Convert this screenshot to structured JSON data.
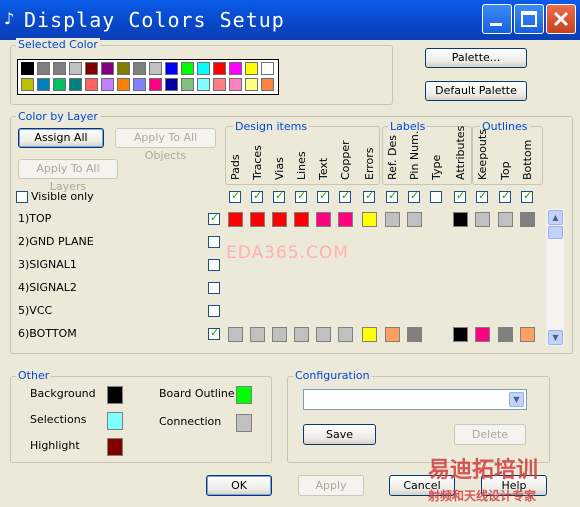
{
  "window": {
    "title": "Display Colors Setup"
  },
  "selected_color": {
    "label": "Selected Color",
    "row1": [
      "#000000",
      "#808080",
      "#808080",
      "#C0C0C0",
      "#800000",
      "#800080",
      "#808000",
      "#808080",
      "#C0C0C0",
      "#0000FF",
      "#00FF00",
      "#00FFFF",
      "#FF0000",
      "#FF00FF",
      "#FFFF00",
      "#FFFFFF"
    ],
    "row2": [
      "#C0C000",
      "#0080C0",
      "#00C060",
      "#008080",
      "#FF6060",
      "#C080FF",
      "#FF8000",
      "#8080FF",
      "#FF0080",
      "#0000A0",
      "#80C080",
      "#80FFFF",
      "#FF8080",
      "#FF80C0",
      "#FFFF80",
      "#FF8040"
    ]
  },
  "buttons": {
    "palette": "Palette...",
    "default_palette": "Default Palette",
    "assign_all": "Assign All",
    "apply_all_objects": "Apply To All Objects",
    "apply_all_layers": "Apply To All Layers",
    "save": "Save",
    "delete": "Delete",
    "ok": "OK",
    "apply": "Apply",
    "cancel": "Cancel",
    "help": "Help"
  },
  "color_by_layer": {
    "label": "Color by Layer",
    "visible_only": "Visible only",
    "group_design": "Design items",
    "group_labels": "Labels",
    "group_outlines": "Outlines",
    "columns": [
      "Pads",
      "Traces",
      "Vias",
      "Lines",
      "Text",
      "Copper",
      "Errors",
      "Ref. Des",
      "Pin Num.",
      "Type",
      "Attributes",
      "Keepouts",
      "Top",
      "Bottom"
    ],
    "column_checked": [
      true,
      true,
      true,
      true,
      true,
      true,
      true,
      true,
      true,
      false,
      true,
      true,
      true,
      true
    ],
    "layers": [
      {
        "name": "1)TOP",
        "checked": true,
        "colors": [
          "#FF0000",
          "#FF0000",
          "#FF0000",
          "#FF0000",
          "#FF0080",
          "#FF0080",
          "#FFFF00",
          "#C0C0C0",
          "#C0C0C0",
          null,
          "#000000",
          "#C0C0C0",
          "#C0C0C0",
          "#808080"
        ]
      },
      {
        "name": "2)GND PLANE",
        "checked": false,
        "colors": []
      },
      {
        "name": "3)SIGNAL1",
        "checked": false,
        "colors": []
      },
      {
        "name": "4)SIGNAL2",
        "checked": false,
        "colors": []
      },
      {
        "name": "5)VCC",
        "checked": false,
        "colors": []
      },
      {
        "name": "6)BOTTOM",
        "checked": true,
        "colors": [
          "#C0C0C0",
          "#C0C0C0",
          "#C0C0C0",
          "#C0C0C0",
          "#C0C0C0",
          "#C0C0C0",
          "#FFFF00",
          "#FFA060",
          "#808080",
          null,
          "#000000",
          "#FF0080",
          "#808080",
          "#FFA060"
        ]
      }
    ]
  },
  "other": {
    "label": "Other",
    "items": [
      {
        "name": "Background",
        "color": "#000000"
      },
      {
        "name": "Selections",
        "color": "#80FFFF"
      },
      {
        "name": "Highlight",
        "color": "#800000"
      },
      {
        "name": "Board Outline",
        "color": "#00FF00"
      },
      {
        "name": "Connection",
        "color": "#C0C0C0"
      }
    ]
  },
  "configuration": {
    "label": "Configuration",
    "value": ""
  },
  "watermark": {
    "center": "EDA365.COM",
    "bottom_big": "易迪拓培训",
    "bottom_small": "射频和天线设计专家"
  }
}
